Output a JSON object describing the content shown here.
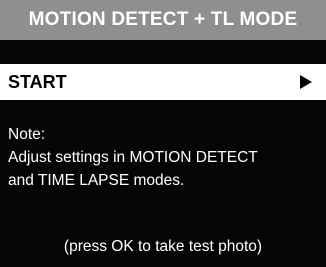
{
  "screen": {
    "title": "MOTION DETECT + TL MODE"
  },
  "menu": {
    "items": [
      {
        "label": "START",
        "selected": true
      }
    ]
  },
  "note": {
    "heading": "Note:",
    "lines": [
      "Adjust settings in MOTION DETECT",
      "and TIME LAPSE modes."
    ]
  },
  "hint": "(press OK to take test photo)",
  "colors": {
    "title_bar": "#8f8f8f",
    "background": "#050505",
    "selected_row": "#ffffff",
    "text": "#ffffff"
  },
  "icons": {
    "menu_arrow": "right-triangle-icon"
  }
}
